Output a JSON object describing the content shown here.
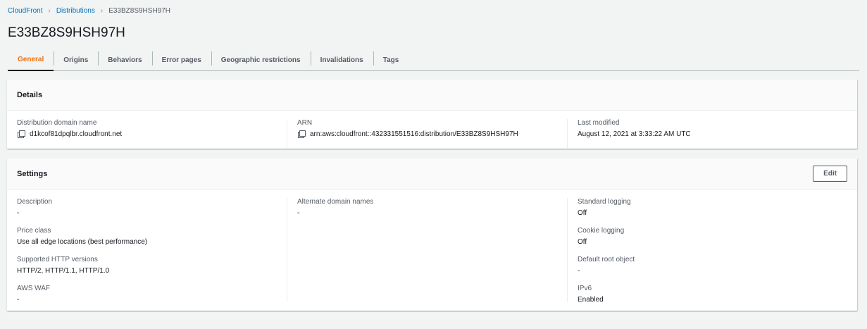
{
  "breadcrumb": [
    "CloudFront",
    "Distributions",
    "E33BZ8S9HSH97H"
  ],
  "title": "E33BZ8S9HSH97H",
  "tabs": [
    "General",
    "Origins",
    "Behaviors",
    "Error pages",
    "Geographic restrictions",
    "Invalidations",
    "Tags"
  ],
  "details": {
    "title": "Details",
    "domain_label": "Distribution domain name",
    "domain": "d1kcof81dpqlbr.cloudfront.net",
    "arn_label": "ARN",
    "arn": "arn:aws:cloudfront::432331551516:distribution/E33BZ8S9HSH97H",
    "modified_label": "Last modified",
    "modified": "August 12, 2021 at 3:33:22 AM UTC"
  },
  "settings": {
    "title": "Settings",
    "edit": "Edit",
    "col1": [
      {
        "label": "Description",
        "value": "-"
      },
      {
        "label": "Price class",
        "value": "Use all edge locations (best performance)"
      },
      {
        "label": "Supported HTTP versions",
        "value": "HTTP/2, HTTP/1.1, HTTP/1.0"
      },
      {
        "label": "AWS WAF",
        "value": "-"
      }
    ],
    "col2": [
      {
        "label": "Alternate domain names",
        "value": "-"
      }
    ],
    "col3": [
      {
        "label": "Standard logging",
        "value": "Off"
      },
      {
        "label": "Cookie logging",
        "value": "Off"
      },
      {
        "label": "Default root object",
        "value": "-"
      },
      {
        "label": "IPv6",
        "value": "Enabled"
      }
    ]
  }
}
